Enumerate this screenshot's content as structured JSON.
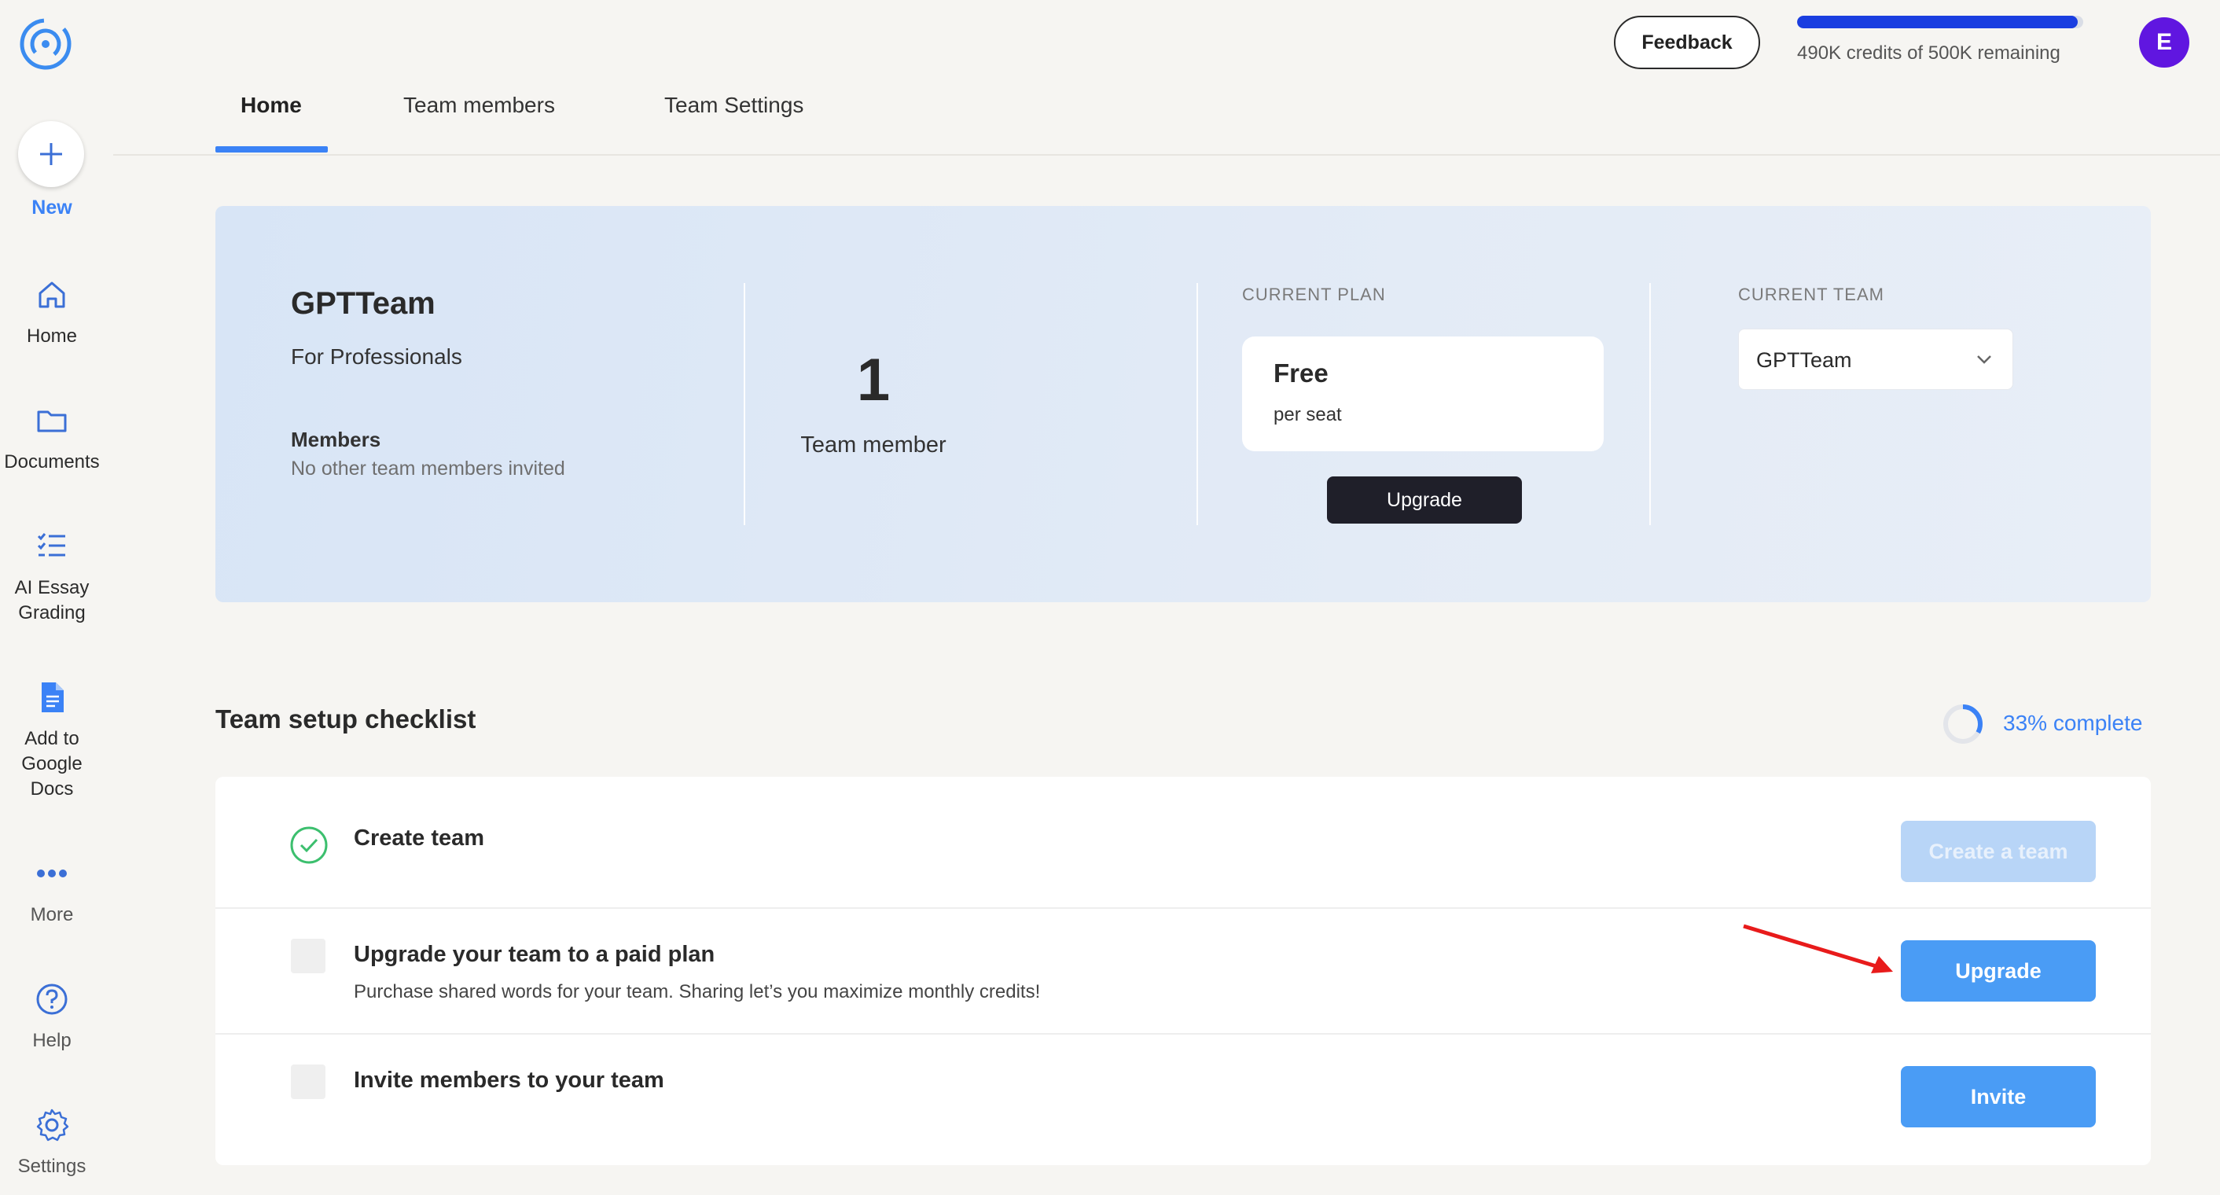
{
  "sidebar": {
    "new_label": "New",
    "items": [
      {
        "label": "Home",
        "icon": "home-icon"
      },
      {
        "label": "Documents",
        "icon": "folder-icon"
      },
      {
        "label": "AI Essay Grading",
        "icon": "checklist-icon"
      },
      {
        "label": "Add to Google Docs",
        "icon": "google-docs-icon"
      },
      {
        "label": "More",
        "icon": "more-icon"
      },
      {
        "label": "Help",
        "icon": "help-icon"
      },
      {
        "label": "Settings",
        "icon": "gear-icon"
      }
    ]
  },
  "header": {
    "feedback_label": "Feedback",
    "credits_text": "490K credits of 500K remaining",
    "credits_fraction": 0.98,
    "avatar_initial": "E"
  },
  "tabs": [
    {
      "label": "Home",
      "active": true
    },
    {
      "label": "Team members",
      "active": false
    },
    {
      "label": "Team Settings",
      "active": false
    }
  ],
  "team_card": {
    "name": "GPTTeam",
    "subtitle": "For Professionals",
    "members_title": "Members",
    "members_note": "No other team members invited",
    "member_count": "1",
    "member_label": "Team member",
    "plan_heading": "CURRENT PLAN",
    "plan_name": "Free",
    "plan_seat": "per seat",
    "upgrade_label": "Upgrade",
    "team_heading": "CURRENT TEAM",
    "team_selected": "GPTTeam"
  },
  "checklist": {
    "title": "Team setup checklist",
    "progress_text": "33% complete",
    "progress_fraction": 0.33,
    "items": [
      {
        "title": "Create team",
        "description": "",
        "done": true,
        "action": "Create a team",
        "action_disabled": true
      },
      {
        "title": "Upgrade your team to a paid plan",
        "description": "Purchase shared words for your team. Sharing let’s you maximize monthly credits!",
        "done": false,
        "action": "Upgrade",
        "action_disabled": false
      },
      {
        "title": "Invite members to your team",
        "description": "",
        "done": false,
        "action": "Invite",
        "action_disabled": false
      }
    ]
  },
  "colors": {
    "accent": "#3b82f6",
    "avatar": "#6016e0",
    "credits_bar": "#1a3ee0",
    "annotation_arrow": "#e81b1b"
  }
}
